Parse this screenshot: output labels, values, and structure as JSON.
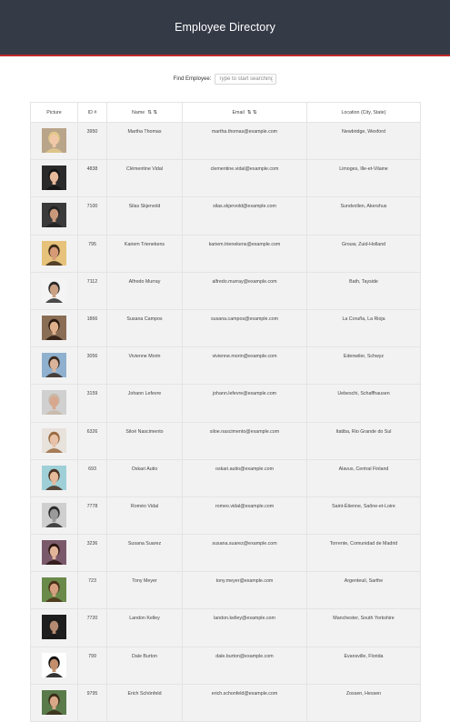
{
  "header": {
    "title": "Employee Directory"
  },
  "search": {
    "label": "Find Employee:",
    "placeholder": "Type to start searching"
  },
  "columns": [
    {
      "label": "Picture",
      "sortable": false
    },
    {
      "label": "ID #",
      "sortable": false
    },
    {
      "label": "Name",
      "sortable": true
    },
    {
      "label": "Email",
      "sortable": true
    },
    {
      "label": "Location (City, State)",
      "sortable": false
    }
  ],
  "sort_icons": "⇅ ⇅",
  "employees": [
    {
      "id": "3950",
      "name": "Martha Thomas",
      "email": "martha.thomas@example.com",
      "location": "Newbridge, Wexford",
      "avatar": {
        "bg": "#b9a58a",
        "skin": "#f0c8a8",
        "hair": "#e3c98a"
      }
    },
    {
      "id": "4838",
      "name": "Clémentine Vidal",
      "email": "clementine.vidal@example.com",
      "location": "Limoges, Ille-et-Vilaine",
      "avatar": {
        "bg": "#2a2a2a",
        "skin": "#e7b99b",
        "hair": "#141414"
      }
    },
    {
      "id": "7100",
      "name": "Silas Skjervold",
      "email": "silas.skjervold@example.com",
      "location": "Sundvollen, Akershus",
      "avatar": {
        "bg": "#3a3a3a",
        "skin": "#c9987a",
        "hair": "#222222"
      }
    },
    {
      "id": "795",
      "name": "Kariem Trienekens",
      "email": "kariem.trienekens@example.com",
      "location": "Grouw, Zuid-Holland",
      "avatar": {
        "bg": "#e6c27a",
        "skin": "#d79a77",
        "hair": "#3a2a1a"
      }
    },
    {
      "id": "7112",
      "name": "Alfredo Murray",
      "email": "alfredo.murray@example.com",
      "location": "Bath, Tayside",
      "avatar": {
        "bg": "#f4f4f4",
        "skin": "#caa083",
        "hair": "#2b2b2b"
      }
    },
    {
      "id": "1866",
      "name": "Susana Campos",
      "email": "susana.campos@example.com",
      "location": "La Coruña, La Rioja",
      "avatar": {
        "bg": "#8a6d55",
        "skin": "#e0b08c",
        "hair": "#2a1a10"
      }
    },
    {
      "id": "3056",
      "name": "Vivienne Morin",
      "email": "vivienne.morin@example.com",
      "location": "Edenwiler, Schwyz",
      "avatar": {
        "bg": "#8fb0cf",
        "skin": "#d9b39a",
        "hair": "#3b2a20"
      }
    },
    {
      "id": "3159",
      "name": "Johann Lefevre",
      "email": "johann.lefevre@example.com",
      "location": "Uebeschi, Schaffhausen",
      "avatar": {
        "bg": "#d0d0d0",
        "skin": "#d8a88e",
        "hair": "#c8b8a8"
      }
    },
    {
      "id": "6326",
      "name": "Siloé Nascimento",
      "email": "siloe.nascimento@example.com",
      "location": "Itatiba, Rio Grande do Sul",
      "avatar": {
        "bg": "#e8e2dc",
        "skin": "#e8c2a8",
        "hair": "#9a6a40"
      }
    },
    {
      "id": "693",
      "name": "Oskari Autio",
      "email": "oskari.autio@example.com",
      "location": "Alavus, Central Finland",
      "avatar": {
        "bg": "#9fd0d8",
        "skin": "#e5b99a",
        "hair": "#4a3020"
      }
    },
    {
      "id": "7778",
      "name": "Roméo Vidal",
      "email": "romeo.vidal@example.com",
      "location": "Saint-Étienne, Saône-et-Loire",
      "avatar": {
        "bg": "#cfcfcf",
        "skin": "#9a9a9a",
        "hair": "#2b2b2b"
      }
    },
    {
      "id": "3236",
      "name": "Susana Suarez",
      "email": "susana.suarez@example.com",
      "location": "Torrente, Comunidad de Madrid",
      "avatar": {
        "bg": "#7a5a6a",
        "skin": "#e2b49a",
        "hair": "#2a1410"
      }
    },
    {
      "id": "723",
      "name": "Tony Meyer",
      "email": "tony.meyer@example.com",
      "location": "Argenteuil, Sarthe",
      "avatar": {
        "bg": "#6a8a4a",
        "skin": "#d5a080",
        "hair": "#4a3018"
      }
    },
    {
      "id": "7720",
      "name": "Landon Kelley",
      "email": "landon.kelley@example.com",
      "location": "Manchester, South Yorkshire",
      "avatar": {
        "bg": "#1e1e1e",
        "skin": "#b48a70",
        "hair": "#1a1a1a"
      }
    },
    {
      "id": "799",
      "name": "Dale Burton",
      "email": "dale.burton@example.com",
      "location": "Evansville, Florida",
      "avatar": {
        "bg": "#ffffff",
        "skin": "#c28e6c",
        "hair": "#111111"
      }
    },
    {
      "id": "9795",
      "name": "Erich Schönfeld",
      "email": "erich.schonfeld@example.com",
      "location": "Zossen, Hessen",
      "avatar": {
        "bg": "#5a7a4a",
        "skin": "#d8a888",
        "hair": "#3a2a18"
      }
    }
  ]
}
